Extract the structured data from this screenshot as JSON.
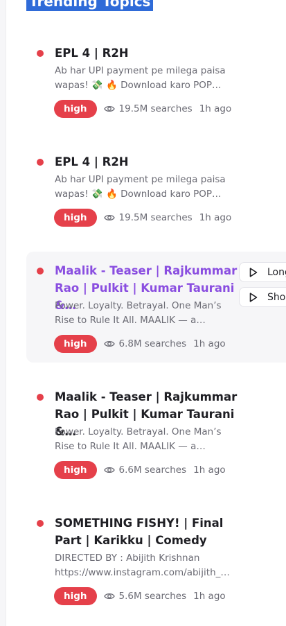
{
  "header": {
    "title": "Trending Topics"
  },
  "items": [
    {
      "title": "EPL 4 | R2H",
      "description": "Ab har UPI payment pe milega paisa wapas! 💸 🔥 Download karo POP…",
      "badge": "high",
      "searches": "19.5M searches",
      "time": "1h ago"
    },
    {
      "title": "EPL 4 | R2H",
      "description": "Ab har UPI payment pe milega paisa wapas! 💸 🔥 Download karo POP…",
      "badge": "high",
      "searches": "19.5M searches",
      "time": "1h ago"
    },
    {
      "title": "Maalik - Teaser | Rajkummar Rao | Pulkit | Kumar Taurani &…",
      "description": "Power. Loyalty. Betrayal. One Man’s Rise to Rule It All. MAALIK — a…",
      "badge": "high",
      "searches": "6.8M searches",
      "time": "1h ago",
      "actions": [
        "Long",
        "Short"
      ]
    },
    {
      "title": "Maalik - Teaser | Rajkummar Rao | Pulkit | Kumar Taurani &…",
      "description": "Power. Loyalty. Betrayal. One Man’s Rise to Rule It All. MAALIK — a…",
      "badge": "high",
      "searches": "6.6M searches",
      "time": "1h ago"
    },
    {
      "title": "SOMETHING FISHY! | Final Part | Karikku | Comedy",
      "description": "DIRECTED BY : Abijith Krishnan https://www.instagram.com/abijith_…",
      "badge": "high",
      "searches": "5.6M searches",
      "time": "1h ago"
    }
  ]
}
